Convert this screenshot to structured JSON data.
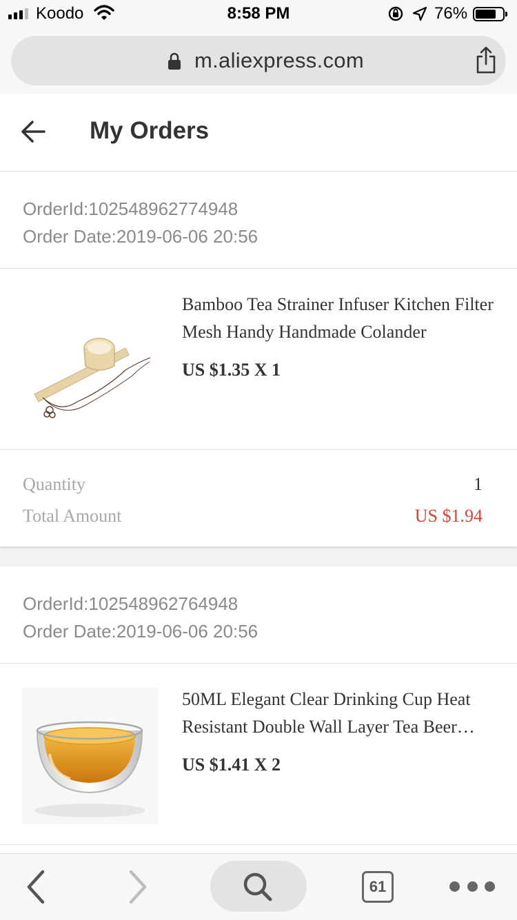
{
  "status_bar": {
    "carrier": "Koodo",
    "time": "8:58 PM",
    "battery_percent": "76%",
    "battery_level": 0.76,
    "signal_bars": 3
  },
  "browser": {
    "url": "m.aliexpress.com",
    "lock_icon": "lock-icon",
    "share_icon": "share-icon",
    "tab_count": "61"
  },
  "header": {
    "title": "My Orders",
    "back_icon": "back-arrow-icon"
  },
  "orders": [
    {
      "order_id": "OrderId:102548962774948",
      "order_date": "Order Date:2019-06-06 20:56",
      "product_title": "Bamboo Tea Strainer Infuser Kitchen Filter Mesh Handy Handmade Colander",
      "product_price": "US $1.35 X 1",
      "quantity_label": "Quantity",
      "quantity_value": "1",
      "total_label": "Total Amount",
      "total_value": "US $1.94"
    },
    {
      "order_id": "OrderId:102548962764948",
      "order_date": "Order Date:2019-06-06 20:56",
      "product_title": "50ML Elegant Clear Drinking Cup Heat Resistant Double Wall Layer Tea Beer…",
      "product_price": "US $1.41 X 2"
    }
  ],
  "colors": {
    "total_red": "#d14637",
    "text_primary": "#333333",
    "text_secondary": "#8a8a8a"
  }
}
